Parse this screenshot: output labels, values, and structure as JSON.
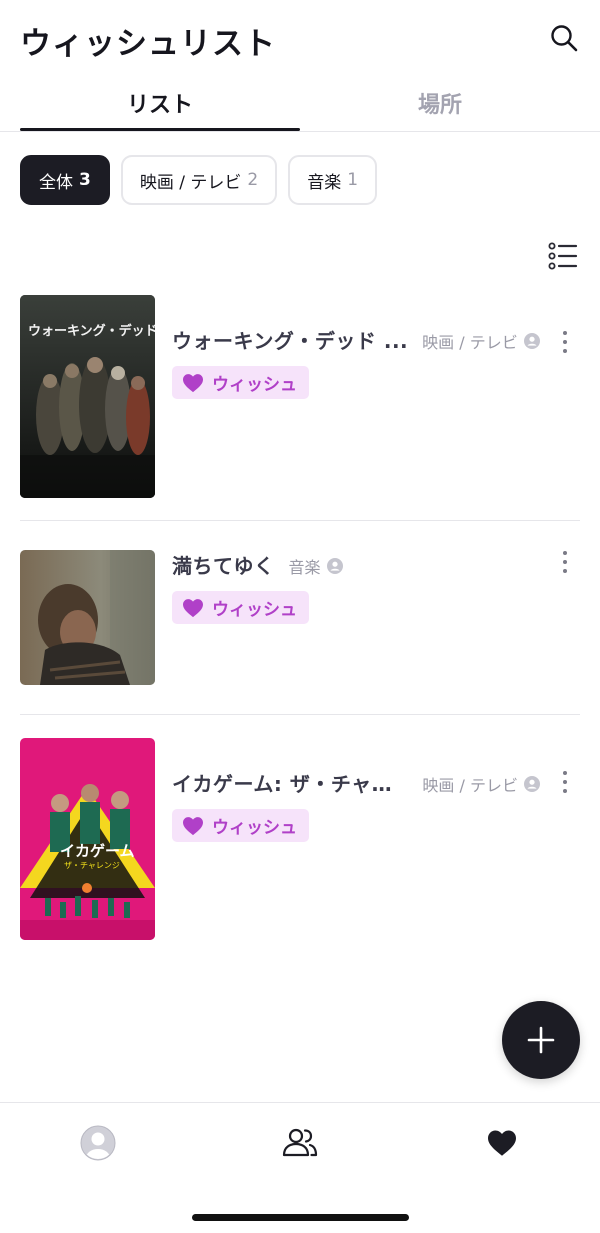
{
  "header": {
    "title": "ウィッシュリスト",
    "search_icon": "search-icon"
  },
  "tabs": [
    {
      "label": "リスト",
      "active": true
    },
    {
      "label": "場所",
      "active": false
    }
  ],
  "filters": [
    {
      "label": "全体",
      "count": "3",
      "active": true
    },
    {
      "label": "映画 / テレビ",
      "count": "2",
      "active": false
    },
    {
      "label": "音楽",
      "count": "1",
      "active": false
    }
  ],
  "view_toggle_icon": "list-view-icon",
  "items": [
    {
      "title": "ウォーキング・デッド ...",
      "category": "映画 / テレビ",
      "badge": "ウィッシュ",
      "poster_title": "ウォーキング・デッド",
      "poster_colors": [
        "#1a1c1a",
        "#3b4038"
      ]
    },
    {
      "title": "満ちてゆく",
      "category": "音楽",
      "badge": "ウィッシュ",
      "poster_colors": [
        "#6b5a44",
        "#2a2520"
      ]
    },
    {
      "title": "イカゲーム: ザ・チャレ...",
      "category": "映画 / テレビ",
      "badge": "ウィッシュ",
      "poster_title": "イカゲーム",
      "poster_subtitle": "ザ・チャレンジ",
      "poster_colors": [
        "#e0187a",
        "#f4e21a"
      ]
    }
  ],
  "colors": {
    "accent_dark": "#1c1c24",
    "wish_bg": "#f6e3fa",
    "wish_fg": "#b040c8",
    "muted": "#9a9aa6"
  },
  "nav": [
    {
      "icon": "avatar-icon",
      "active": false
    },
    {
      "icon": "friends-icon",
      "active": false
    },
    {
      "icon": "heart-icon",
      "active": true
    }
  ],
  "fab_icon": "plus-icon"
}
